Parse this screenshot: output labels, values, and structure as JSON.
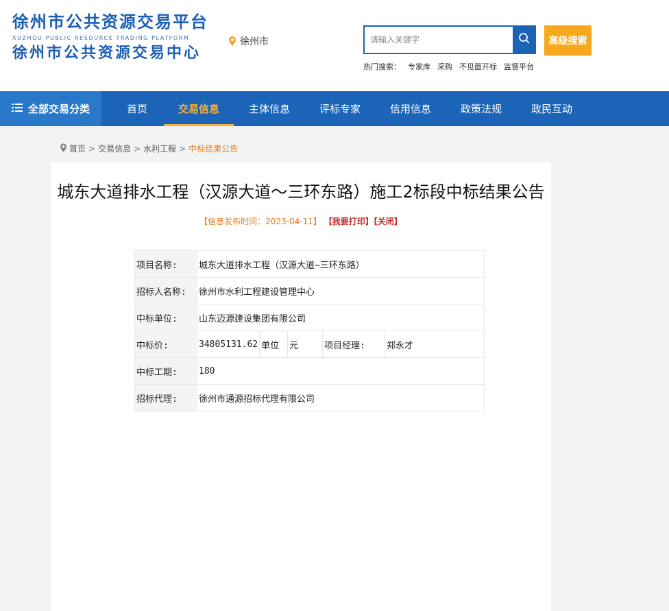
{
  "header": {
    "logo_line1": "徐州市公共资源交易平台",
    "logo_line2": "XUZHOU PUBLIC RESOURCE TRADING PLATFORM",
    "logo_line3": "徐州市公共资源交易中心",
    "location": "徐州市",
    "search_placeholder": "请输入关键字",
    "advanced_search_label": "高级搜索",
    "hot_label": "热门搜索：",
    "hot_links": [
      "专家库",
      "采购",
      "不见面开标",
      "监督平台"
    ]
  },
  "nav": {
    "category_label": "全部交易分类",
    "items": [
      "首页",
      "交易信息",
      "主体信息",
      "评标专家",
      "信用信息",
      "政策法规",
      "政民互动"
    ],
    "active": "交易信息"
  },
  "breadcrumb": [
    "首页",
    "交易信息",
    "水利工程",
    "中标结果公告"
  ],
  "article": {
    "title": "城东大道排水工程（汉源大道～三环东路）施工2标段中标结果公告",
    "publish_prefix": "【信息发布时间：",
    "publish_date": "2023-04-11",
    "publish_suffix": "】",
    "print_label": "【我要打印】",
    "close_label": "【关闭】"
  },
  "info": {
    "project_name_label": "项目名称:",
    "project_name": "城东大道排水工程（汉源大道~三环东路）",
    "tenderer_label": "招标人名称:",
    "tenderer": "徐州市水利工程建设管理中心",
    "winner_label": "中标单位:",
    "winner": "山东迈源建设集团有限公司",
    "price_label": "中标价:",
    "price": "34805131.62",
    "unit_label": "单位",
    "unit": "元",
    "manager_label": "项目经理:",
    "manager": "郑永才",
    "period_label": "中标工期:",
    "period": "180",
    "agent_label": "招标代理:",
    "agent": "徐州市通源招标代理有限公司"
  },
  "colors": {
    "brand_blue": "#1c64b7",
    "accent_orange": "#f8a81c",
    "active_nav": "#ffb02e"
  },
  "icons": [
    "location-pin-icon",
    "search-icon",
    "menu-icon",
    "breadcrumb-pin-icon"
  ]
}
